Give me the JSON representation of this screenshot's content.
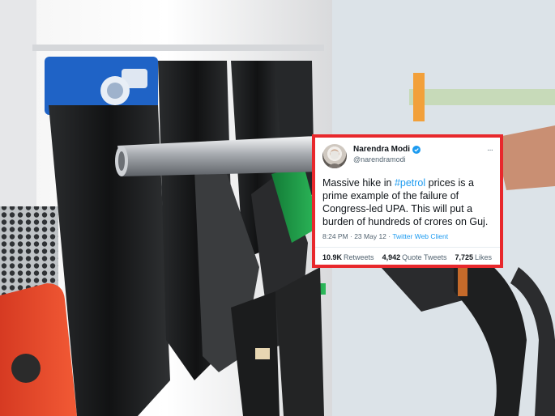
{
  "photo": {
    "description_icon": "fuel-pump-photo"
  },
  "tweet": {
    "author_name": "Narendra Modi",
    "handle": "@narendramodi",
    "text_before_hashtag": "Massive hike in ",
    "hashtag": "#petrol",
    "text_after_hashtag": " prices is a prime example of the failure of Congress-led UPA. This will put a burden of hundreds of crores on Guj.",
    "timestamp": "8:24 PM · 23 May 12 · ",
    "client": "Twitter Web Client",
    "retweets_count": "10.9K",
    "retweets_label": "Retweets",
    "quote_count": "4,942",
    "quote_label": "Quote Tweets",
    "likes_count": "7,725",
    "likes_label": "Likes",
    "more_icon": "more-icon",
    "verified_icon": "verified-badge-icon"
  },
  "colors": {
    "card_border": "#e8282c",
    "link_blue": "#1d9bf0",
    "pump_red": "#e8452a",
    "nozzle_green": "#1f9a4a"
  }
}
